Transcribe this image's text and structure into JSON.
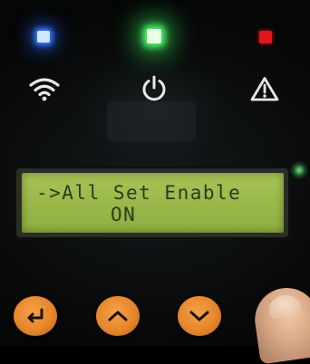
{
  "lcd": {
    "line1": "->All Set Enable",
    "line2": "ON"
  },
  "indicators": {
    "wifi": {
      "icon": "wifi-icon",
      "color": "#3a7dff"
    },
    "power": {
      "icon": "power-icon",
      "color": "#4cff6a"
    },
    "alarm": {
      "icon": "warning-icon",
      "color": "#e0161b"
    }
  },
  "buttons": [
    {
      "name": "enter-button",
      "icon": "enter-arrow-icon"
    },
    {
      "name": "up-button",
      "icon": "chevron-up-icon"
    },
    {
      "name": "down-button",
      "icon": "chevron-down-icon"
    }
  ],
  "colors": {
    "lcd_background": "#9bb84a",
    "lcd_text": "#2c3a1f",
    "button": "#e7862b",
    "panel": "#0b0d0e"
  }
}
